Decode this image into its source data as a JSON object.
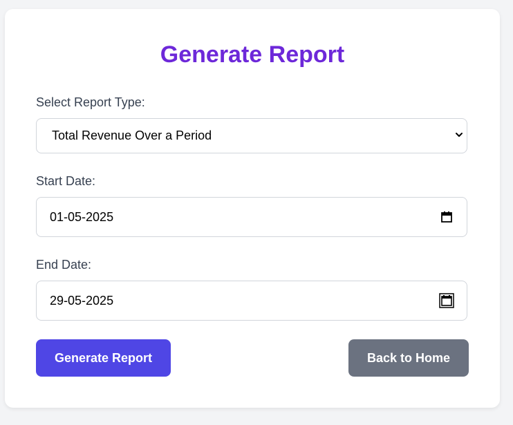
{
  "form": {
    "title": "Generate Report",
    "report_type_label": "Select Report Type:",
    "report_type_value": "Total Revenue Over a Period",
    "start_date_label": "Start Date:",
    "start_date_value": "01-05-2025",
    "end_date_label": "End Date:",
    "end_date_value": "29-05-2025"
  },
  "actions": {
    "generate_label": "Generate Report",
    "back_label": "Back to Home"
  },
  "colors": {
    "title": "#6d28d9",
    "primary_button": "#4f46e5",
    "secondary_button": "#6b7280",
    "background": "#f3f4f6"
  },
  "icons": {
    "select_arrow": "chevron-down-icon",
    "date_picker": "calendar-icon"
  }
}
